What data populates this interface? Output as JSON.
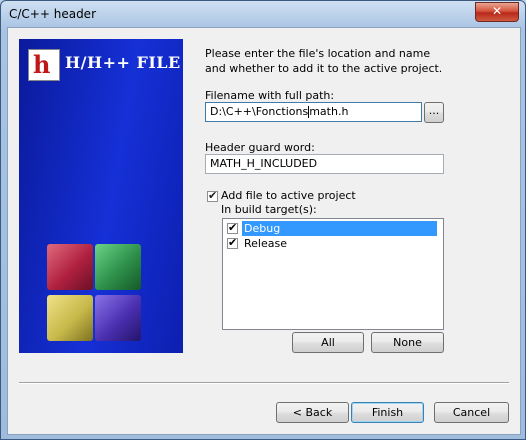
{
  "window": {
    "title": "C/C++ header",
    "close_glyph": "✕"
  },
  "banner": {
    "logo_letter": "h",
    "title": "H/H++ FILE",
    "cube_colors": [
      "#b0203f",
      "#2e8f4a",
      "#c8b94a",
      "#4a2fb0"
    ]
  },
  "intro_text": "Please enter the file's location and name and whether to add it to the active project.",
  "filename": {
    "label": "Filename with full path:",
    "value_before_caret": "D:\\C++\\Fonctions",
    "value_after_caret": "math.h",
    "browse_label": "..."
  },
  "guard": {
    "label": "Header guard word:",
    "value": "MATH_H_INCLUDED"
  },
  "add_to_project": {
    "label": "Add file to active project",
    "checked": true,
    "check_glyph": "✔"
  },
  "build_targets": {
    "label": "In build target(s):",
    "items": [
      {
        "label": "Debug",
        "checked": true,
        "selected": true
      },
      {
        "label": "Release",
        "checked": true,
        "selected": false
      }
    ],
    "all_label": "All",
    "none_label": "None"
  },
  "footer": {
    "back_label": "< Back",
    "finish_label": "Finish",
    "cancel_label": "Cancel"
  },
  "colors": {
    "banner_blue": "#1530d6",
    "selection": "#3399ff"
  }
}
